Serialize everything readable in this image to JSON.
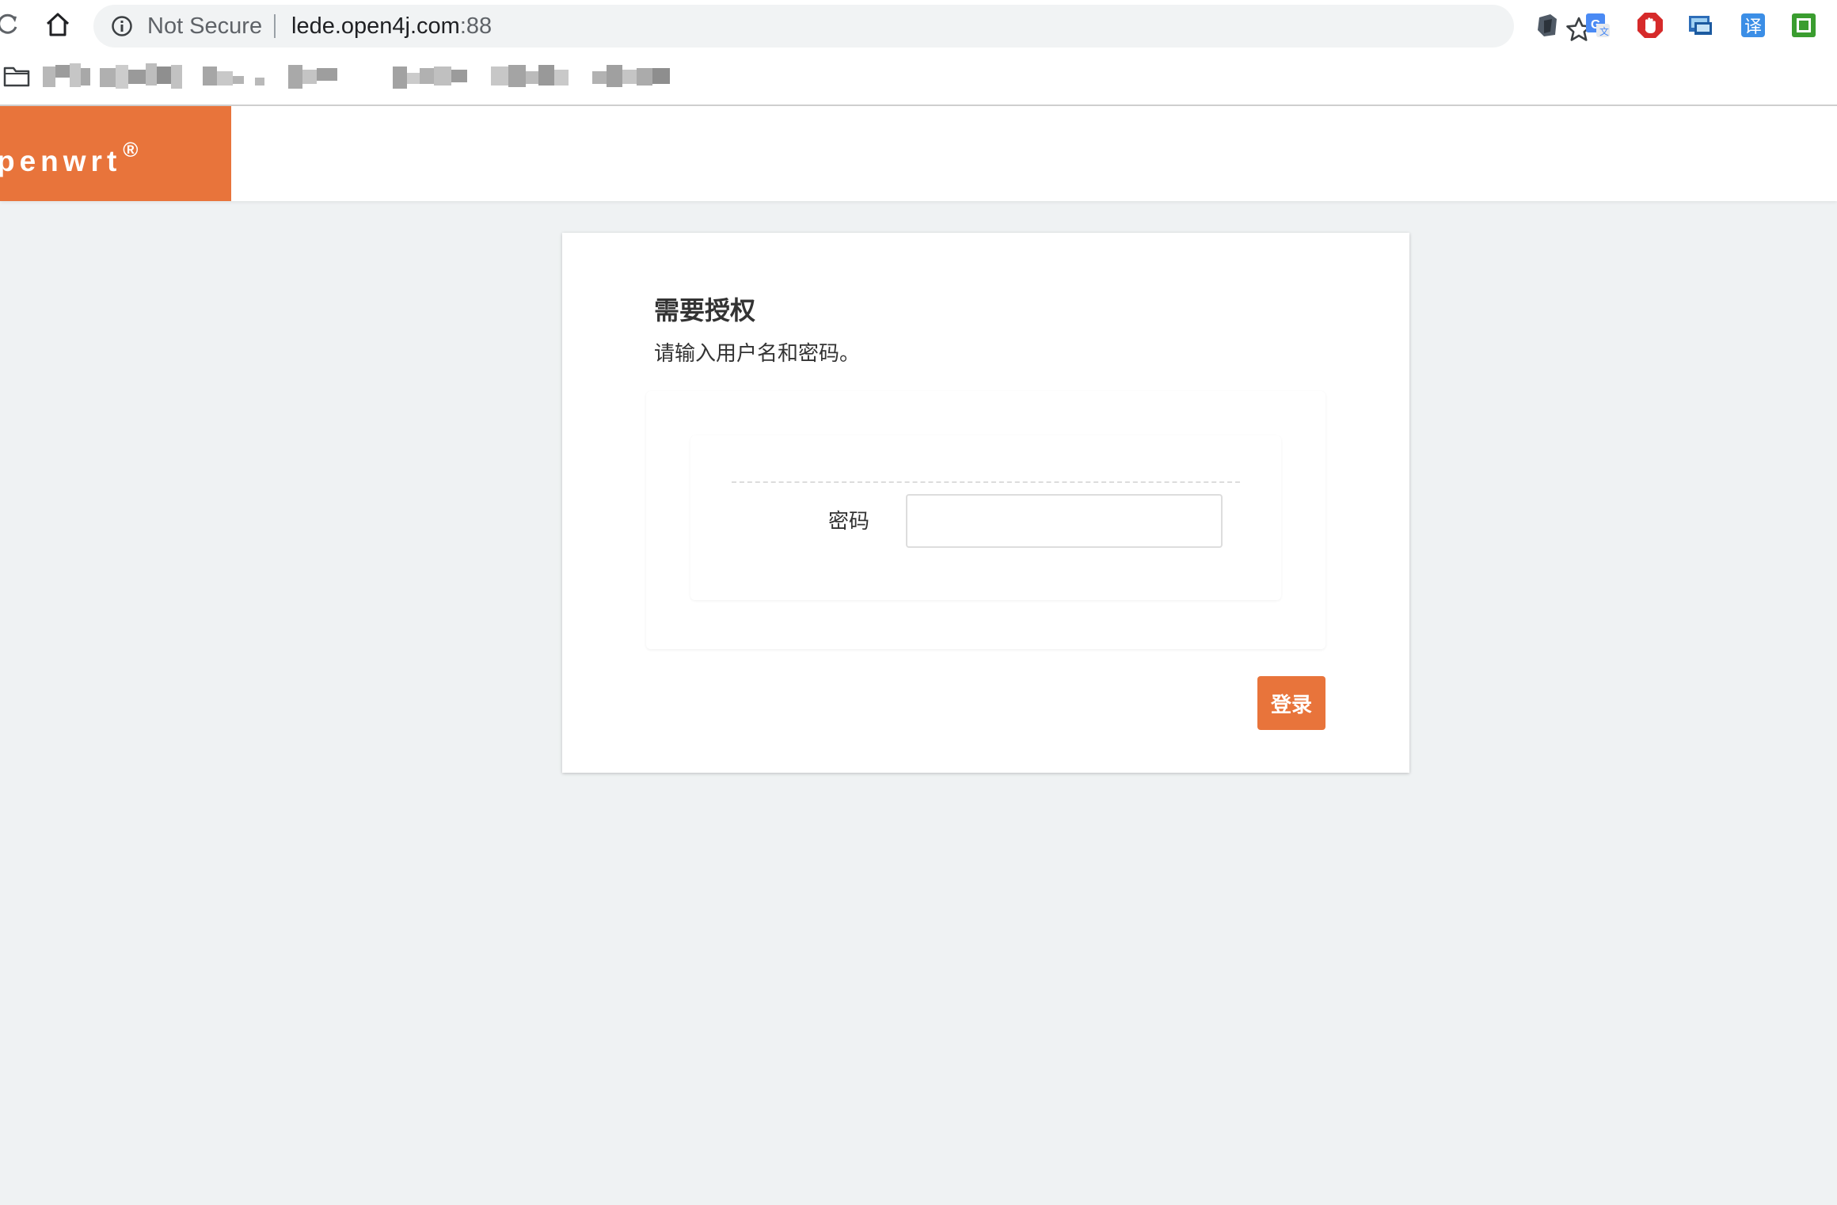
{
  "browser": {
    "security_label": "Not Secure",
    "url_host": "lede.open4j.com",
    "url_port": ":88",
    "extensions": [
      "dark-mode-icon",
      "translate-icon",
      "adblock-stop-icon",
      "screen-capture-icon",
      "translate-cn-icon",
      "green-square-icon"
    ],
    "extension_translate_cn_glyph": "译"
  },
  "header": {
    "brand": "penwrt",
    "brand_mark": "®",
    "brand_color": "#e8743b"
  },
  "login": {
    "title": "需要授权",
    "description": "请输入用户名和密码。",
    "password_label": "密码",
    "password_value": "",
    "submit_label": "登录",
    "button_color": "#e8743b"
  }
}
